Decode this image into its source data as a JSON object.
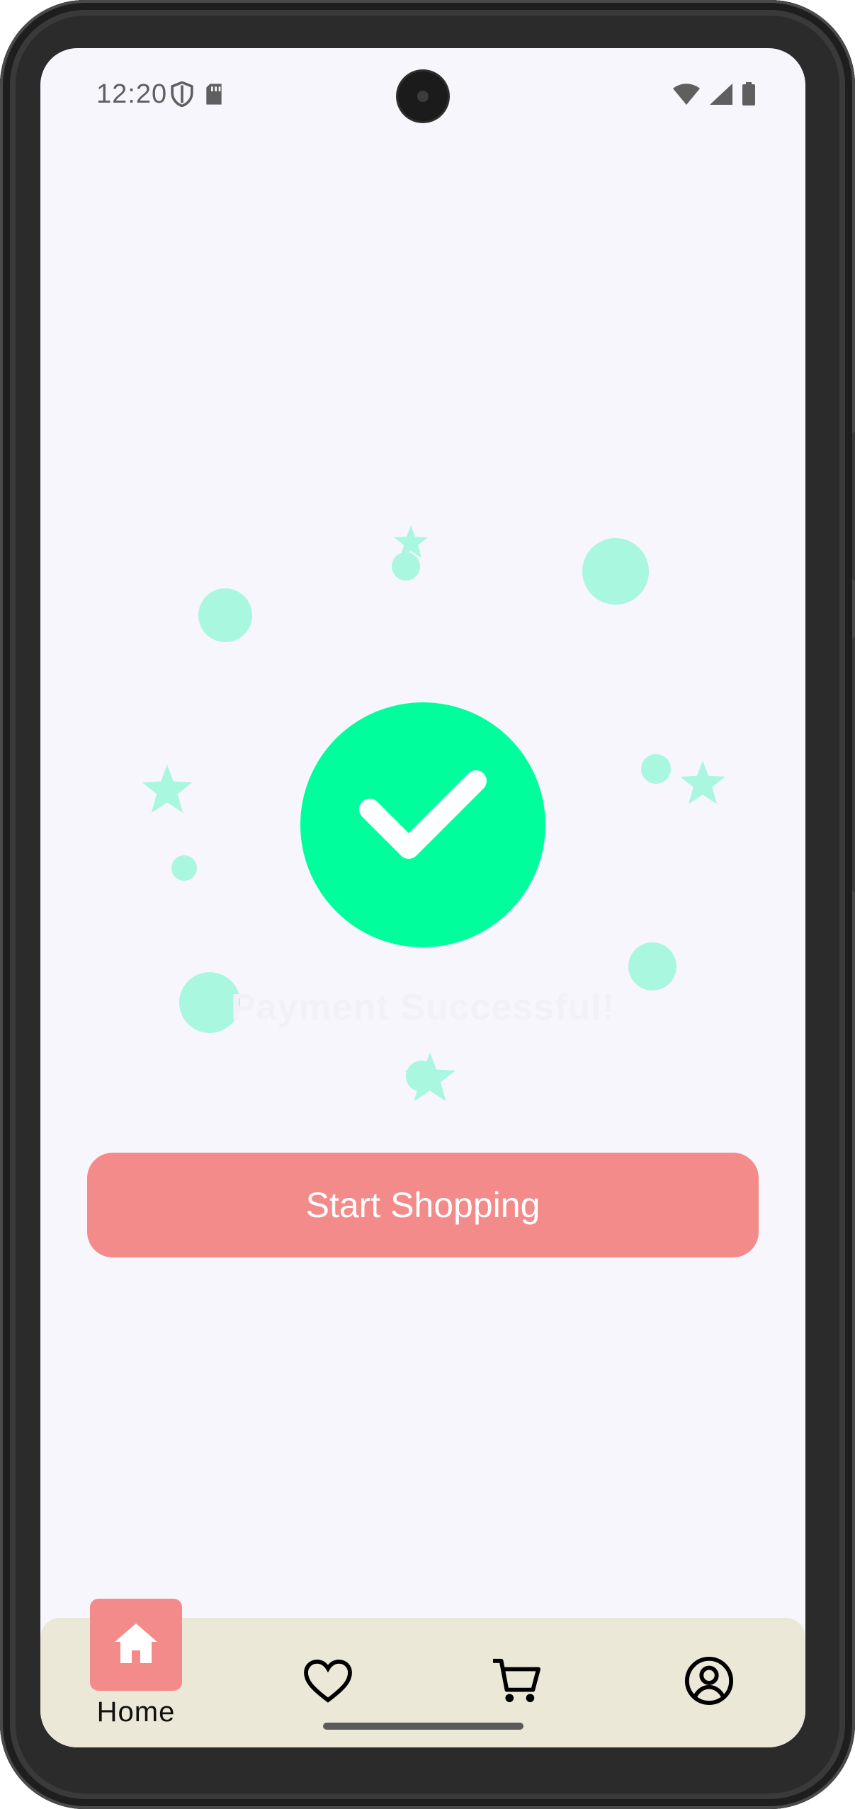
{
  "status_bar": {
    "time": "12:20",
    "icons": [
      "shield-icon",
      "sd-card-icon",
      "wifi-icon",
      "signal-icon",
      "battery-icon"
    ]
  },
  "success": {
    "message": "Payment Successful!",
    "icon": "check-icon",
    "accent_color": "#00ff9c",
    "confetti_color": "#aaf7df"
  },
  "actions": {
    "start_shopping_label": "Start Shopping",
    "button_color": "#f48b8b"
  },
  "bottom_nav": {
    "items": [
      {
        "label": "Home",
        "icon": "home-icon",
        "active": true
      },
      {
        "label": "",
        "icon": "heart-icon",
        "active": false
      },
      {
        "label": "",
        "icon": "cart-icon",
        "active": false
      },
      {
        "label": "",
        "icon": "account-icon",
        "active": false
      }
    ],
    "background": "#ece8d7"
  }
}
